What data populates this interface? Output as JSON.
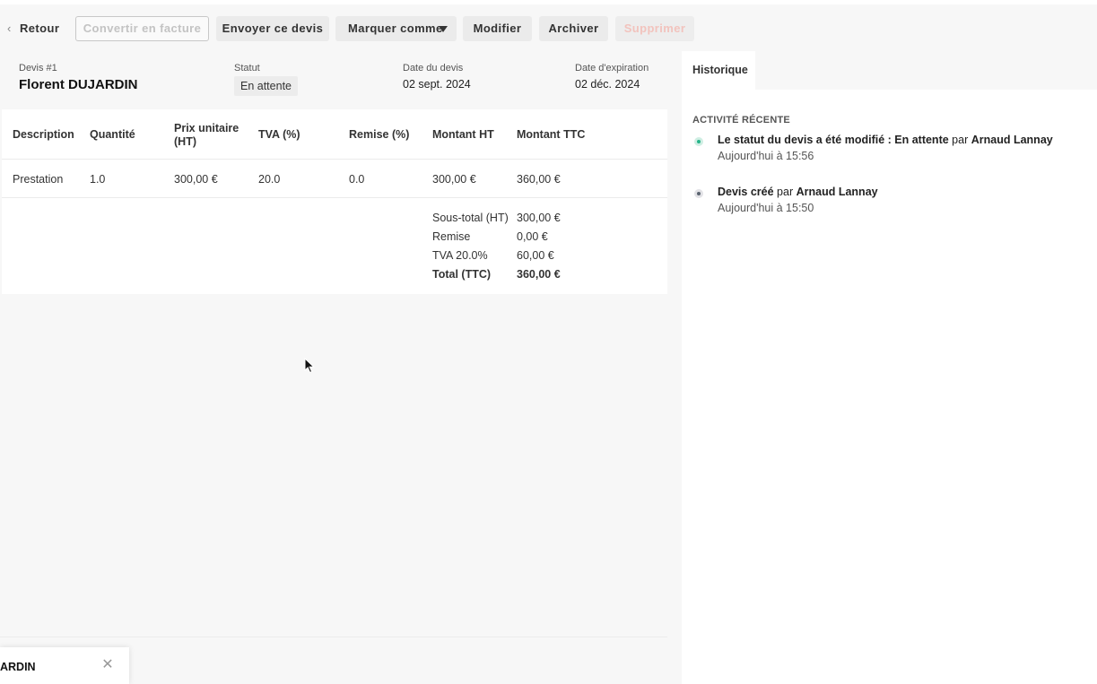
{
  "toolbar": {
    "back": "Retour",
    "convert": "Convertir en facture",
    "send": "Envoyer ce devis",
    "mark_as": "Marquer comme",
    "edit": "Modifier",
    "archive": "Archiver",
    "delete": "Supprimer"
  },
  "quote": {
    "number_label": "Devis #1",
    "client": "Florent DUJARDIN",
    "status_label": "Statut",
    "status": "En attente",
    "date_label": "Date du devis",
    "date": "02 sept. 2024",
    "expiry_label": "Date d'expiration",
    "expiry": "02 déc. 2024"
  },
  "table": {
    "headers": {
      "description": "Description",
      "quantity": "Quantité",
      "unit_price_1": "Prix unitaire",
      "unit_price_2": "(HT)",
      "vat": "TVA (%)",
      "discount": "Remise (%)",
      "amount_ht": "Montant HT",
      "amount_ttc": "Montant TTC"
    },
    "rows": [
      {
        "description": "Prestation",
        "quantity": "1.0",
        "unit_price": "300,00 €",
        "vat": "20.0",
        "discount": "0.0",
        "amount_ht": "300,00 €",
        "amount_ttc": "360,00 €"
      }
    ]
  },
  "summary": {
    "subtotal_label": "Sous-total (HT)",
    "subtotal": "300,00 €",
    "discount_label": "Remise",
    "discount": "0,00 €",
    "vat_label": "TVA 20.0%",
    "vat": "60,00 €",
    "total_label": "Total (TTC)",
    "total": "360,00 €"
  },
  "toast": {
    "text": "ARDIN"
  },
  "history": {
    "tab": "Historique",
    "section_title": "ACTIVITÉ RÉCENTE",
    "items": [
      {
        "text": "Le statut du devis a été modifié : En attente",
        "by": "par",
        "author": "Arnaud Lannay",
        "time": "Aujourd'hui à 15:56"
      },
      {
        "text": "Devis créé",
        "by": "par",
        "author": "Arnaud Lannay",
        "time": "Aujourd'hui à 15:50"
      }
    ]
  },
  "colors": {
    "accent_green": "#27b48a",
    "delete_disabled": "#f2c3bd"
  },
  "icons": {
    "back": "chevron-left-icon",
    "dropdown": "caret-down-icon",
    "close": "close-icon",
    "cursor": "mouse-pointer-icon"
  }
}
